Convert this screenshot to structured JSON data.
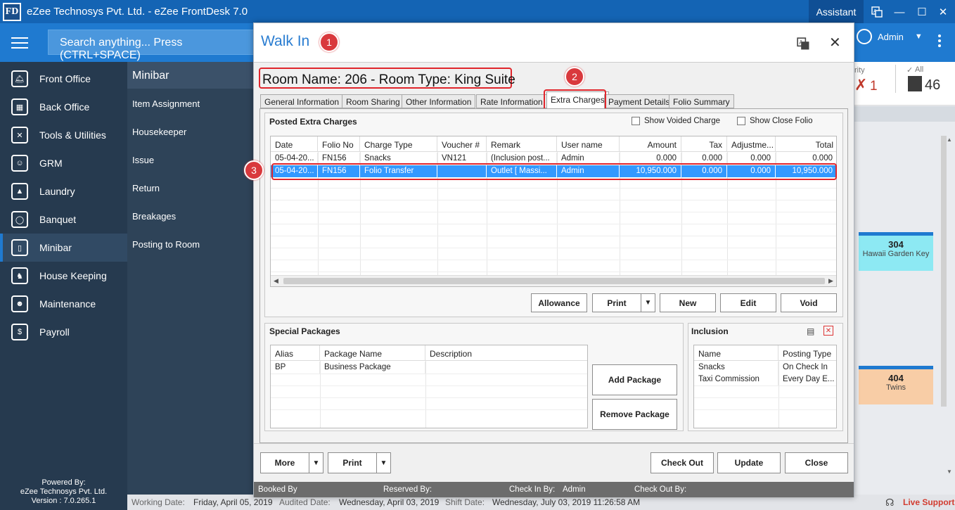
{
  "app": {
    "logo": "FD",
    "title": "eZee Technosys Pvt. Ltd. - eZee FrontDesk 7.0",
    "assistant": "Assistant",
    "window_icons": [
      "translate-icon",
      "minimize-icon",
      "maximize-icon",
      "close-icon"
    ]
  },
  "toolbar": {
    "search_placeholder": "Search anything... Press (CTRL+SPACE)",
    "user": "Admin"
  },
  "sidebar": {
    "items": [
      {
        "label": "Front Office",
        "icon": "bell-icon"
      },
      {
        "label": "Back Office",
        "icon": "building-icon"
      },
      {
        "label": "Tools & Utilities",
        "icon": "tools-icon"
      },
      {
        "label": "GRM",
        "icon": "grm-icon"
      },
      {
        "label": "Laundry",
        "icon": "iron-icon"
      },
      {
        "label": "Banquet",
        "icon": "dining-icon"
      },
      {
        "label": "Minibar",
        "icon": "fridge-icon"
      },
      {
        "label": "House Keeping",
        "icon": "housekeeping-icon"
      },
      {
        "label": "Maintenance",
        "icon": "worker-icon"
      },
      {
        "label": "Payroll",
        "icon": "payroll-icon"
      }
    ],
    "active": "Minibar",
    "powered": [
      "Powered By:",
      "eZee Technosys Pvt. Ltd.",
      "Version : 7.0.265.1"
    ]
  },
  "submenu": {
    "header": "Minibar",
    "items": [
      "Item Assignment",
      "Housekeeper",
      "Issue",
      "Return",
      "Breakages",
      "Posting to Room"
    ]
  },
  "background": {
    "counter1_label": "rity",
    "counter1_value": "1",
    "counter2_label": "All",
    "counter2_value": "46",
    "room1_number": "304",
    "room1_type": "Hawaii Garden Key",
    "room2_number": "404",
    "room2_type": "Twins",
    "live_support": "Live Support"
  },
  "statusbar": {
    "working_label": "Working Date:",
    "working_value": "Friday, April 05, 2019",
    "audited_label": "Audited Date:",
    "audited_value": "Wednesday, April 03, 2019",
    "shift_label": "Shift Date:",
    "shift_value": "Wednesday, July 03, 2019 11:26:58 AM"
  },
  "dialog": {
    "title": "Walk In",
    "room_heading": "Room Name: 206 - Room Type: King Suite",
    "tabs": [
      "General Information",
      "Room Sharing",
      "Other Information",
      "Rate Information",
      "Extra Charges",
      "Payment Details",
      "Folio Summary"
    ],
    "selected_tab": "Extra Charges",
    "callouts": [
      "1",
      "2",
      "3"
    ],
    "posted": {
      "title": "Posted Extra Charges",
      "show_voided": "Show Voided Charge",
      "show_close_folio": "Show Close Folio",
      "columns": [
        "Date",
        "Folio No",
        "Charge Type",
        "Voucher #",
        "Remark",
        "User name",
        "Amount",
        "Tax",
        "Adjustme...",
        "Total"
      ],
      "rows": [
        [
          "05-04-20...",
          "FN156",
          "Snacks",
          "VN121",
          "(Inclusion post...",
          "Admin",
          "0.000",
          "0.000",
          "0.000",
          "0.000"
        ],
        [
          "05-04-20...",
          "FN156",
          "Folio Transfer",
          "",
          "Outlet [ Massi...",
          "Admin",
          "10,950.000",
          "0.000",
          "0.000",
          "10,950.000"
        ]
      ],
      "buttons": {
        "allowance": "Allowance",
        "print": "Print",
        "new": "New",
        "edit": "Edit",
        "void": "Void"
      }
    },
    "packages": {
      "title": "Special Packages",
      "columns": [
        "Alias",
        "Package Name",
        "Description"
      ],
      "rows": [
        [
          "BP",
          "Business Package",
          ""
        ]
      ],
      "add": "Add Package",
      "remove": "Remove Package"
    },
    "inclusion": {
      "title": "Inclusion",
      "columns": [
        "Name",
        "Posting Type"
      ],
      "rows": [
        [
          "Snacks",
          "On Check In"
        ],
        [
          "Taxi Commission",
          "Every Day E..."
        ]
      ]
    },
    "bottom": {
      "more": "More",
      "print": "Print",
      "checkout": "Check Out",
      "update": "Update",
      "close": "Close"
    },
    "footer": {
      "booked_by": "Booked By",
      "reserved_by": "Reserved By:",
      "checkin_by": "Check In By:",
      "checkin_value": "Admin",
      "checkout_by": "Check Out By:"
    }
  }
}
